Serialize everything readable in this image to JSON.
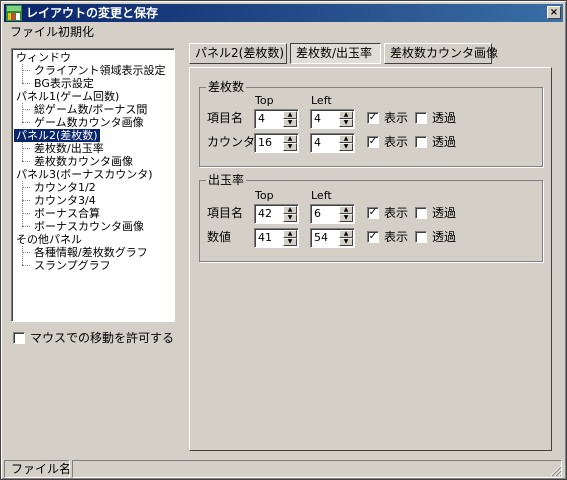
{
  "window": {
    "title": "レイアウトの変更と保存",
    "close_glyph": "×"
  },
  "menu": {
    "file": "ファイル",
    "init": "初期化"
  },
  "tree": {
    "items": [
      {
        "label": "ウィンドウ",
        "level": 1
      },
      {
        "label": "クライアント領域表示設定",
        "level": 2
      },
      {
        "label": "BG表示設定",
        "level": 2
      },
      {
        "label": "パネル1(ゲーム回数)",
        "level": 1
      },
      {
        "label": "総ゲーム数/ボーナス間",
        "level": 2
      },
      {
        "label": "ゲーム数カウンタ画像",
        "level": 2
      },
      {
        "label": "パネル2(差枚数)",
        "level": 1,
        "selected": true
      },
      {
        "label": "差枚数/出玉率",
        "level": 2
      },
      {
        "label": "差枚数カウンタ画像",
        "level": 2
      },
      {
        "label": "パネル3(ボーナスカウンタ)",
        "level": 1
      },
      {
        "label": "カウンタ1/2",
        "level": 2
      },
      {
        "label": "カウンタ3/4",
        "level": 2
      },
      {
        "label": "ボーナス合算",
        "level": 2
      },
      {
        "label": "ボーナスカウンタ画像",
        "level": 2
      },
      {
        "label": "その他パネル",
        "level": 1
      },
      {
        "label": "各種情報/差枚数グラフ",
        "level": 2
      },
      {
        "label": "スランプグラフ",
        "level": 2
      }
    ]
  },
  "mouse_move": {
    "label": "マウスでの移動を許可する",
    "checked": false
  },
  "tabs": [
    {
      "label": "パネル2(差枚数)",
      "active": false
    },
    {
      "label": "差枚数/出玉率",
      "active": true
    },
    {
      "label": "差枚数カウンタ画像",
      "active": false
    }
  ],
  "groups": {
    "samaisu": {
      "title": "差枚数",
      "col_top": "Top",
      "col_left": "Left",
      "rows": [
        {
          "label": "項目名",
          "top": "4",
          "left": "4",
          "show_label": "表示",
          "show": true,
          "trans_label": "透過",
          "trans": false
        },
        {
          "label": "カウンタ",
          "top": "16",
          "left": "4",
          "show_label": "表示",
          "show": true,
          "trans_label": "透過",
          "trans": false
        }
      ]
    },
    "dedama": {
      "title": "出玉率",
      "col_top": "Top",
      "col_left": "Left",
      "rows": [
        {
          "label": "項目名",
          "top": "42",
          "left": "6",
          "show_label": "表示",
          "show": true,
          "trans_label": "透過",
          "trans": false
        },
        {
          "label": "数値",
          "top": "41",
          "left": "54",
          "show_label": "表示",
          "show": true,
          "trans_label": "透過",
          "trans": false
        }
      ]
    }
  },
  "status": {
    "filename_label": "ファイル名",
    "filename_value": ""
  },
  "colors": {
    "titlebar_start": "#0a246a",
    "titlebar_end": "#3a6ea5",
    "face": "#d4d0c8",
    "selection": "#0a246a"
  },
  "icons": {
    "app": "app-icon",
    "close": "close-icon",
    "check": "✓",
    "spin_up": "▲",
    "spin_down": "▼"
  }
}
